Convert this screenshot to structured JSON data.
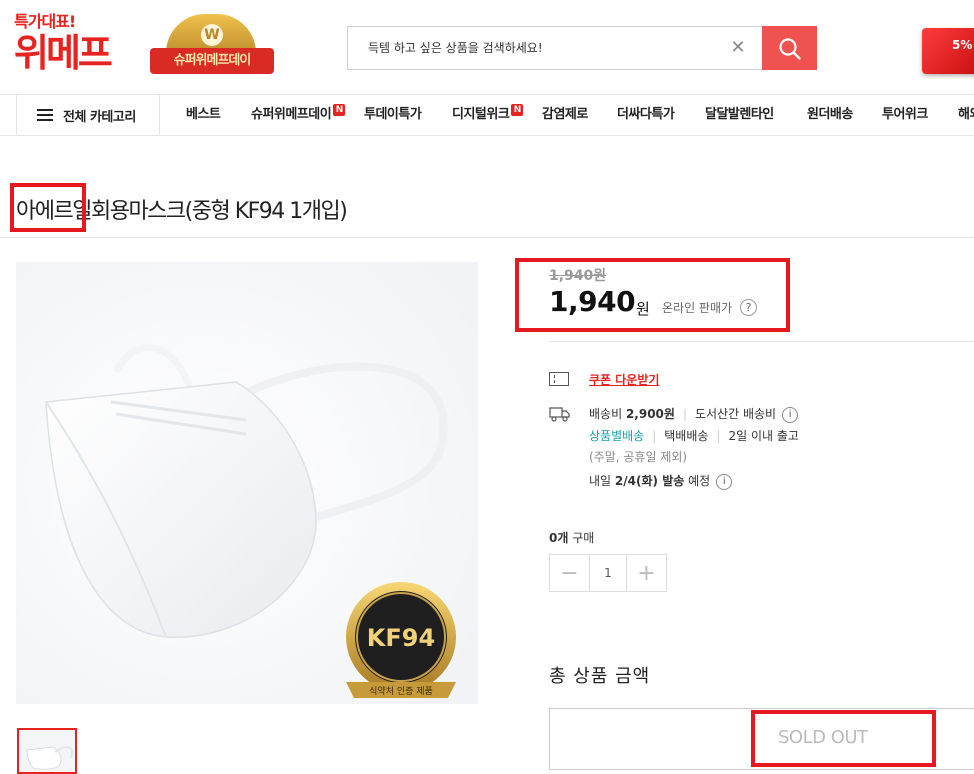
{
  "header": {
    "slogan": "특가대표!",
    "brand": "위메프",
    "promo_badge_text": "슈퍼위메프데이",
    "promo_badge_letter": "W",
    "card_text": "5%"
  },
  "search": {
    "placeholder": "득템 하고 싶은 상품을 검색하세요!",
    "clear_icon": "close-icon",
    "button_icon": "search-icon"
  },
  "nav": {
    "all_categories": "전체 카테고리",
    "items": [
      {
        "label": "베스트"
      },
      {
        "label": "슈퍼위메프데이",
        "badge": "N"
      },
      {
        "label": "투데이특가"
      },
      {
        "label": "디지털위크",
        "badge": "N"
      },
      {
        "label": "감염제로"
      },
      {
        "label": "더싸다특가"
      },
      {
        "label": "달달발렌타인"
      },
      {
        "label": "원더배송"
      },
      {
        "label": "투어위크"
      },
      {
        "label": "해외"
      }
    ]
  },
  "product": {
    "title": "아에르일회용마스크(중형 KF94 1개입)",
    "cert_badge": "KF94",
    "cert_caption": "식약처 인증 제품"
  },
  "price": {
    "original": "1,940원",
    "current": "1,940",
    "unit": "원",
    "note": "온라인 판매가",
    "help": "?"
  },
  "coupon": {
    "label": "쿠폰 다운받기"
  },
  "shipping": {
    "fee_label": "배송비",
    "fee_value": "2,900원",
    "island_fee": "도서산간 배송비",
    "bundle": "상품별배송",
    "method": "택배배송",
    "dispatch": "2일 이내 출고",
    "note": "(주말, 공휴일 제외)",
    "eta_prefix": "내일",
    "eta_date": "2/4(화) 발송",
    "eta_suffix": "예정",
    "info": "i"
  },
  "quantity": {
    "count_label": "0개",
    "label": "구매",
    "value": "1",
    "minus": "−",
    "plus": "+"
  },
  "total": {
    "label": "총 상품 금액"
  },
  "buy": {
    "soldout": "SOLD OUT"
  }
}
